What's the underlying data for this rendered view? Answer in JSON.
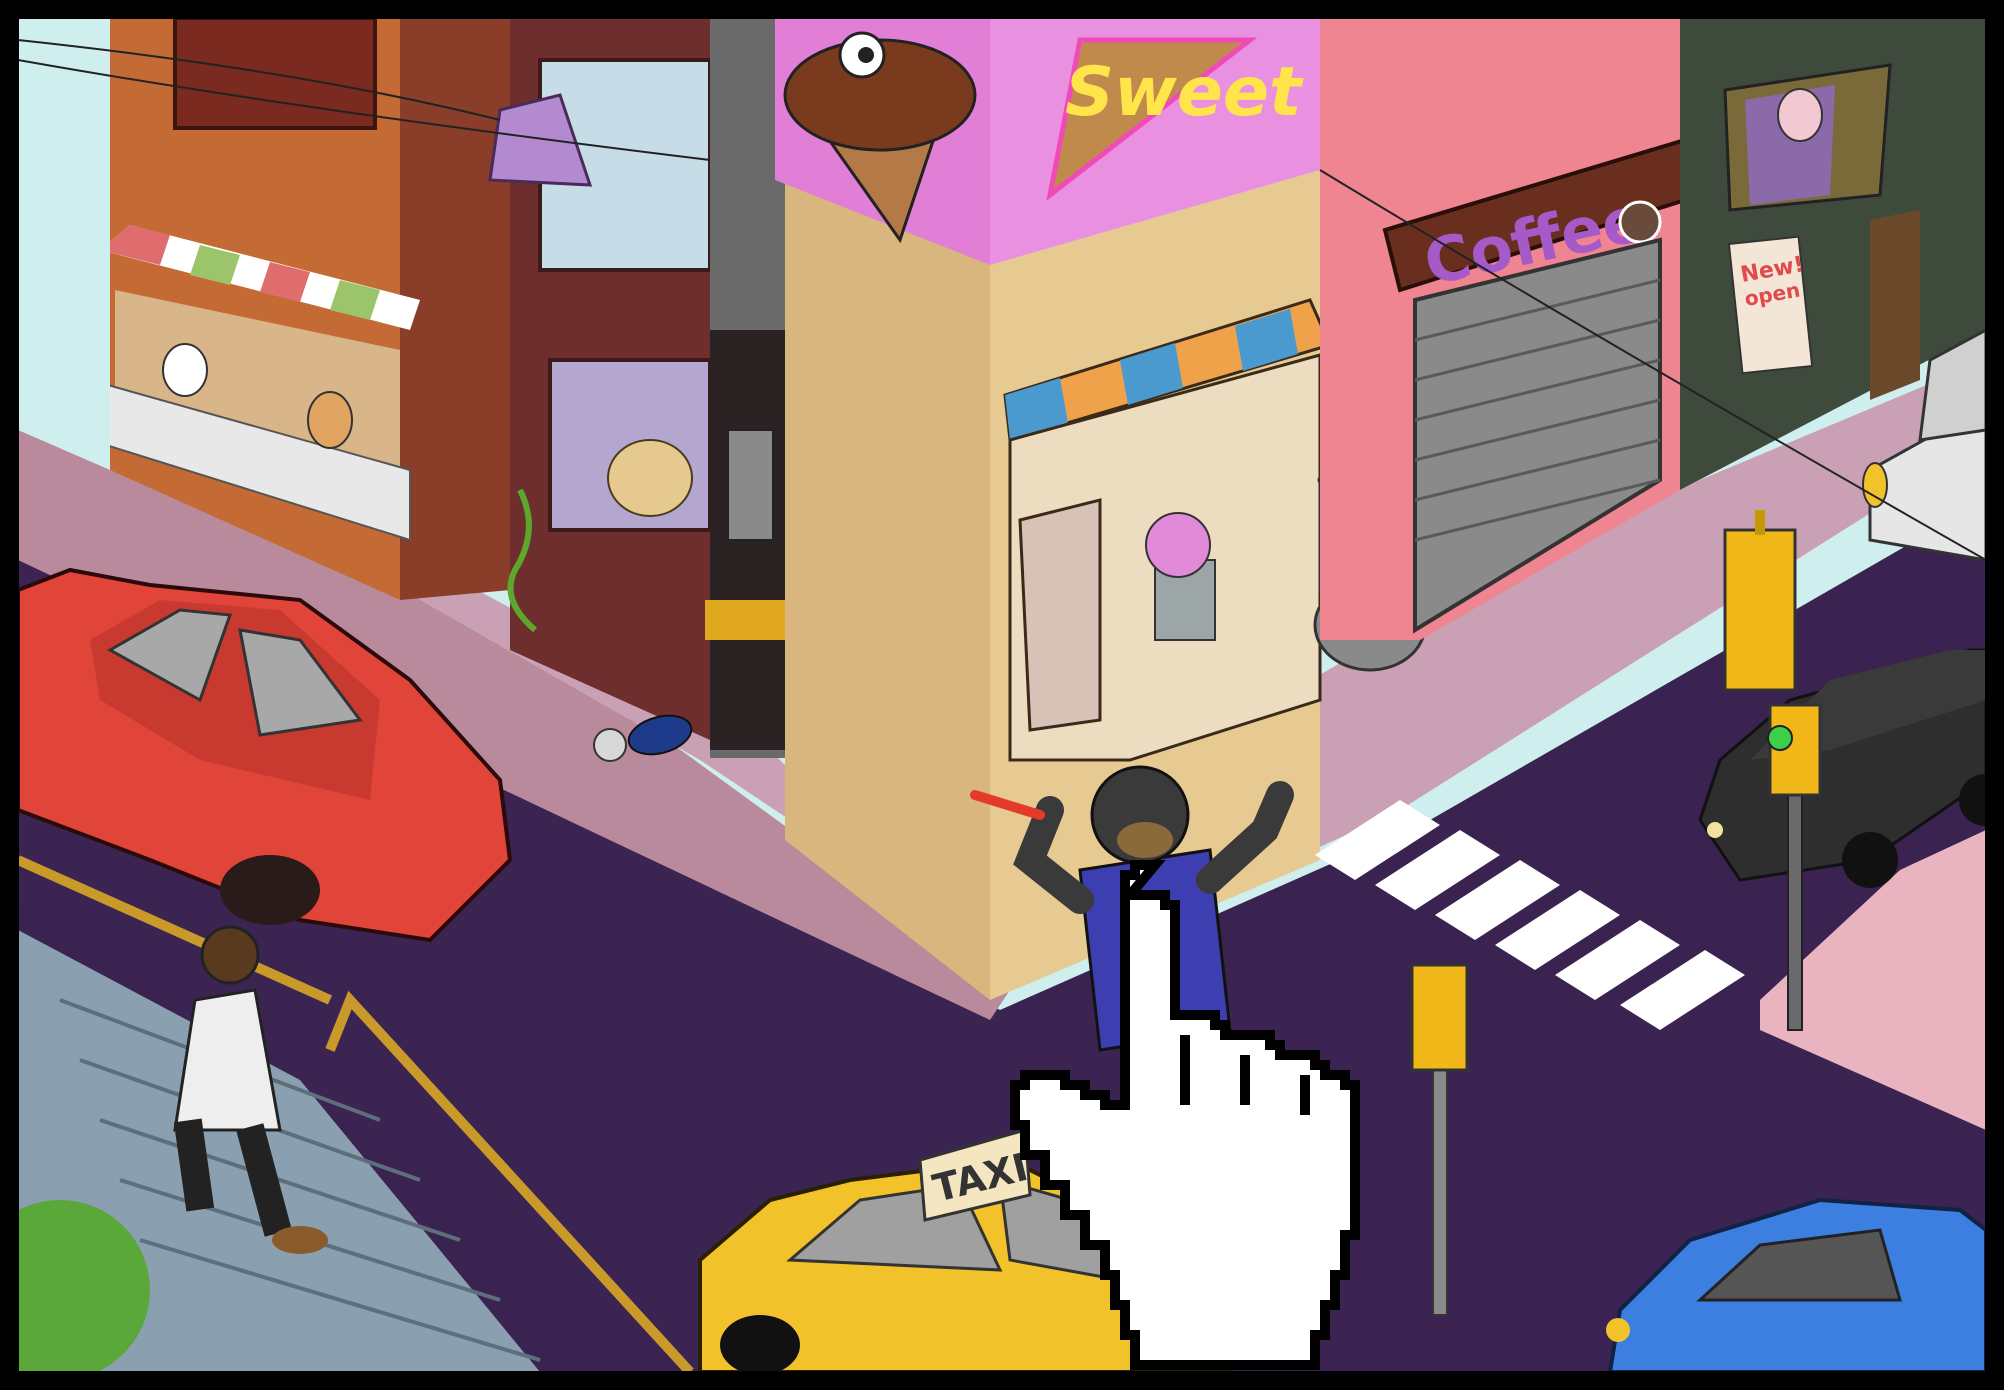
{
  "scene": {
    "title": "",
    "colors": {
      "frame": "#000000",
      "street": "#3a2350",
      "sidewalk": "#c9a0b4",
      "sweet_building": "#e7c992",
      "sweet_sign": "#e17fd6",
      "coffee_wall": "#f08592",
      "green_building": "#3e4b3c",
      "orange_building": "#c46a35",
      "red_car": "#e1453a",
      "taxi": "#f2c22a",
      "black_car": "#2e2e2e",
      "white_car": "#e6e6e6",
      "blue_car": "#3d7fe0",
      "police_uniform": "#3d3fb0",
      "crosswalk": "#ffffff"
    }
  },
  "signs": {
    "sweet": "Sweet",
    "coffee": "Coffee",
    "new_open_line1": "New!",
    "new_open_line2": "open",
    "taxi": "TAXI"
  },
  "cursor": {
    "icon": "pointing-hand-cursor-icon"
  }
}
